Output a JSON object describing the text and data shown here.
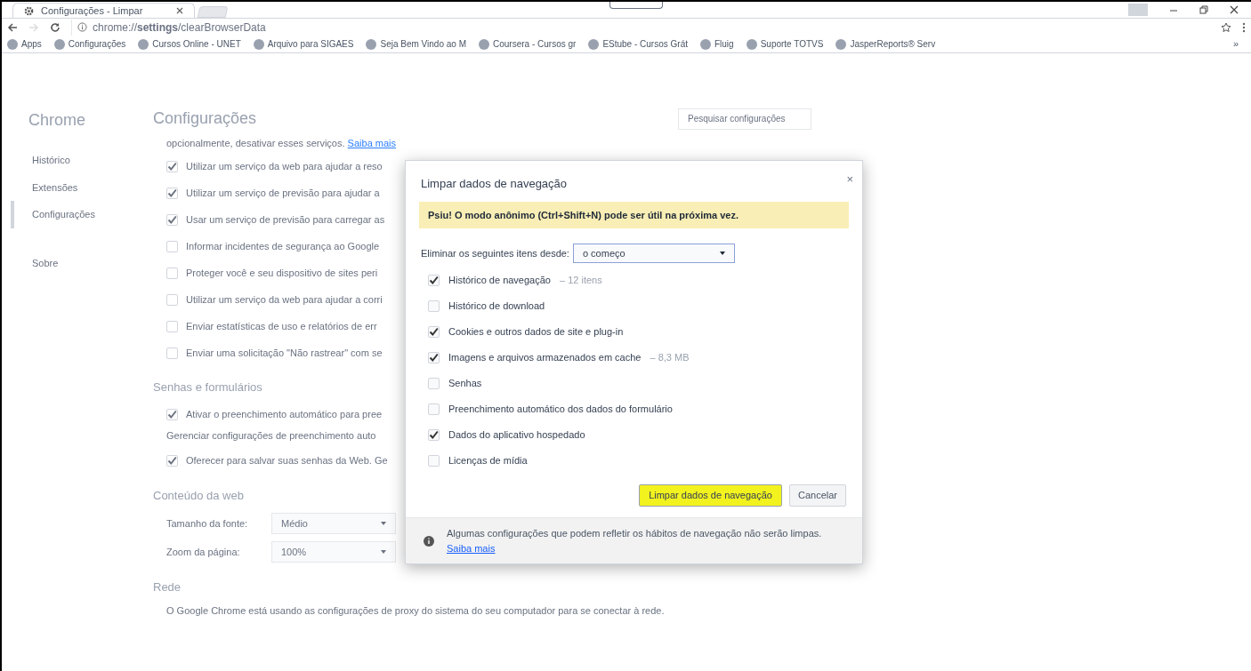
{
  "browser": {
    "tabs": [
      {
        "title": "Configurações - Limpar",
        "selected": true
      }
    ],
    "address": "chrome://**settings**/clearBrowserData",
    "bookmarks": [
      {
        "label": "Apps"
      },
      {
        "label": "Configurações"
      },
      {
        "label": "Cursos Online - UNET"
      },
      {
        "label": "Arquivo para SIGAES"
      },
      {
        "label": "Seja Bem Vindo ao M"
      },
      {
        "label": "Coursera - Cursos gr"
      },
      {
        "label": "EStube - Cursos Grát"
      },
      {
        "label": "Fluig"
      },
      {
        "label": "Suporte TOTVS"
      },
      {
        "label": "JasperReports® Serv"
      }
    ],
    "bookmarks_overflow": "»"
  },
  "settings": {
    "brand": "Chrome",
    "title": "Configurações",
    "search_placeholder": "Pesquisar configurações",
    "nav": [
      {
        "label": "Histórico",
        "selected": false
      },
      {
        "label": "Extensões",
        "selected": false
      },
      {
        "label": "Configurações",
        "selected": true
      },
      {
        "label": "Sobre",
        "selected": false
      }
    ],
    "content": [
      {
        "kind": "paragraph",
        "text": "opcionalmente, desativar esses serviços.",
        "link": "Saiba mais"
      },
      {
        "kind": "checkbox",
        "text": "Utilizar um serviço da web para ajudar a reso",
        "checked": true
      },
      {
        "kind": "checkbox",
        "text": "Utilizar um serviço de previsão para ajudar a",
        "checked": true
      },
      {
        "kind": "checkbox",
        "text": "Usar um serviço de previsão para carregar as",
        "checked": true
      },
      {
        "kind": "checkbox",
        "text": "Informar incidentes de segurança ao Google",
        "checked": false
      },
      {
        "kind": "checkbox",
        "text": "Proteger você e seu dispositivo de sites peri",
        "checked": false
      },
      {
        "kind": "checkbox",
        "text": "Utilizar um serviço da web para ajudar a corri",
        "checked": false
      },
      {
        "kind": "checkbox",
        "text": "Enviar estatísticas de uso e relatórios de err",
        "checked": false
      },
      {
        "kind": "checkbox",
        "text": "Enviar uma solicitação \"Não rastrear\" com se",
        "checked": false
      },
      {
        "kind": "heading",
        "text": "Senhas e formulários"
      },
      {
        "kind": "checkbox",
        "text": "Ativar o preenchimento automático para pree",
        "checked": true
      },
      {
        "kind": "link",
        "text": "Gerenciar configurações de preenchimento auto"
      },
      {
        "kind": "checkbox",
        "text": "Oferecer para salvar suas senhas da Web. Ge",
        "checked": true
      },
      {
        "kind": "heading",
        "text": "Conteúdo da web"
      },
      {
        "kind": "select",
        "text": "Tamanho da fonte:",
        "value": "Médio"
      },
      {
        "kind": "select",
        "text": "Zoom da página:",
        "value": "100%"
      },
      {
        "kind": "heading",
        "text": "Rede"
      },
      {
        "kind": "paragraph",
        "text": "O Google Chrome está usando as configurações de proxy do sistema do seu computador para se conectar à rede."
      }
    ]
  },
  "dialog": {
    "title": "Limpar dados de navegação",
    "close": "×",
    "notice": "Psiu! O modo anônimo (Ctrl+Shift+N) pode ser útil na próxima vez.",
    "range_label": "Eliminar os seguintes itens desde:",
    "range_value": "o começo",
    "items": [
      {
        "label": "Histórico de navegação",
        "detail": "– 12 itens",
        "checked": true
      },
      {
        "label": "Histórico de download",
        "checked": false
      },
      {
        "label": "Cookies e outros dados de site e plug-in",
        "checked": true
      },
      {
        "label": "Imagens e arquivos armazenados em cache",
        "detail": "– 8,3 MB",
        "checked": true
      },
      {
        "label": "Senhas",
        "checked": false
      },
      {
        "label": "Preenchimento automático dos dados do formulário",
        "checked": false
      },
      {
        "label": "Dados do aplicativo hospedado",
        "checked": true
      },
      {
        "label": "Licenças de mídia",
        "checked": false
      }
    ],
    "primary_button": "Limpar dados de navegação",
    "cancel_button": "Cancelar",
    "footer_text": "Algumas configurações que podem refletir os hábitos de navegação não serão limpas.",
    "footer_link": "Saiba mais"
  }
}
